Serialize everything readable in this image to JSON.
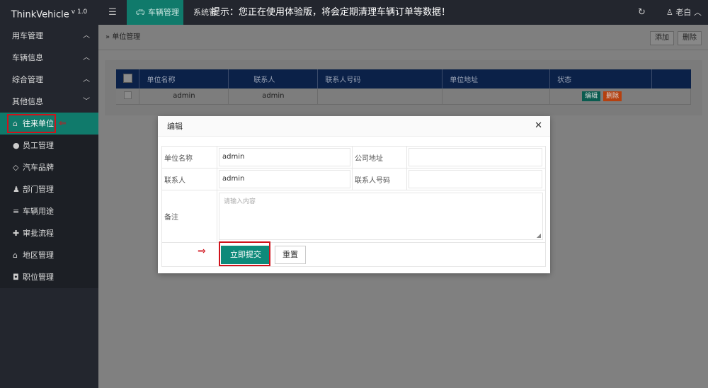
{
  "app": {
    "name": "ThinkVehicle",
    "version": "v 1.0"
  },
  "topbar": {
    "menu_icon": "menu-icon",
    "active_tab": "车辆管理",
    "tab2": "系统管",
    "notice": "提示：您正在使用体验版，将会定期清理车辆订单等数据！",
    "user": "老白",
    "refresh_icon": "refresh-icon"
  },
  "sidebar": {
    "groups": [
      "用车管理",
      "车辆信息",
      "综合管理",
      "其他信息"
    ],
    "items": [
      {
        "label": "往来单位",
        "icon": "bank-icon"
      },
      {
        "label": "员工管理",
        "icon": "user-icon"
      },
      {
        "label": "汽车品牌",
        "icon": "diamond-icon"
      },
      {
        "label": "部门管理",
        "icon": "users-icon"
      },
      {
        "label": "车辆用途",
        "icon": "list-icon"
      },
      {
        "label": "审批流程",
        "icon": "puzzle-icon"
      },
      {
        "label": "地区管理",
        "icon": "home-icon"
      },
      {
        "label": "职位管理",
        "icon": "camera-icon"
      }
    ]
  },
  "page": {
    "breadcrumb": "单位管理",
    "add_label": "添加",
    "delete_label": "删除"
  },
  "table": {
    "headers": [
      "单位名称",
      "联系人",
      "联系人号码",
      "单位地址",
      "状态"
    ],
    "rows": [
      {
        "name": "admin",
        "contact": "admin",
        "phone": "",
        "address": "",
        "edit": "编辑",
        "del": "删除"
      }
    ]
  },
  "modal": {
    "title": "编辑",
    "fields": {
      "unit_name_label": "单位名称",
      "unit_name_value": "admin",
      "company_addr_label": "公司地址",
      "company_addr_value": "",
      "contact_label": "联系人",
      "contact_value": "admin",
      "contact_phone_label": "联系人号码",
      "contact_phone_value": "",
      "note_label": "备注",
      "note_placeholder": "请输入内容"
    },
    "submit_label": "立即提交",
    "reset_label": "重置"
  },
  "colors": {
    "accent": "#0e8a7a",
    "highlight": "#d0121b",
    "header_blue": "#0b2148"
  }
}
